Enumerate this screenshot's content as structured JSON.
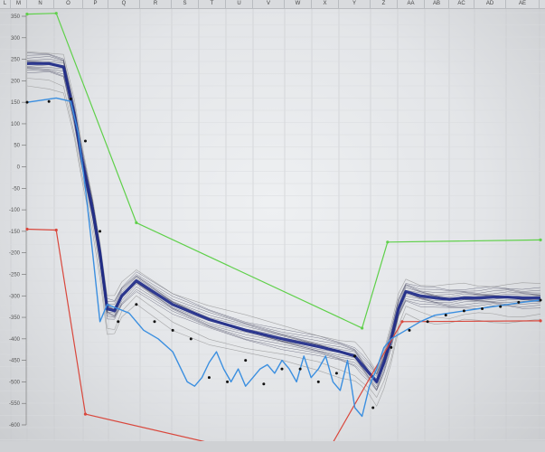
{
  "spreadsheet": {
    "columns": [
      "L",
      "M",
      "N",
      "O",
      "P",
      "Q",
      "R",
      "S",
      "T",
      "U",
      "V",
      "W",
      "X",
      "Y",
      "Z",
      "AA",
      "AB",
      "AC",
      "AD",
      "AE"
    ]
  },
  "chart_data": {
    "type": "line",
    "ylim": [
      -620,
      380
    ],
    "y_ticks": [
      350,
      300,
      250,
      200,
      150,
      100,
      50,
      0,
      -50,
      -100,
      -150,
      -200,
      -250,
      -300,
      -350,
      -400,
      -450,
      -500,
      -550,
      -600
    ],
    "y_tick_labels": [
      "350",
      "300",
      "250",
      "200",
      "150",
      "100",
      "50",
      "0",
      "-50",
      "-100",
      "-150",
      "-200",
      "-250",
      "-300",
      "-350",
      "-400",
      "-450",
      "-500",
      "-550",
      "-600"
    ],
    "grid": true,
    "colors": {
      "upper_limit": "#5fd04a",
      "lower_limit": "#d9473c",
      "mean": "#1e2a8a",
      "measured": "#3b8fe0",
      "envelope": "#202040",
      "gray_traces": "#8a8a8a"
    },
    "series": [
      {
        "role": "upper-limit",
        "x": [
          0,
          8,
          30,
          92,
          99,
          141
        ],
        "y": [
          355,
          357,
          -130,
          -375,
          -175,
          -170
        ]
      },
      {
        "role": "lower-limit",
        "x": [
          0,
          8,
          16,
          80,
          103,
          141
        ],
        "y": [
          -145,
          -147,
          -575,
          -700,
          -360,
          -358
        ]
      },
      {
        "role": "mean-trace",
        "x": [
          0,
          6,
          10,
          13,
          15,
          18,
          20,
          22,
          24,
          26,
          30,
          40,
          50,
          60,
          70,
          80,
          86,
          90,
          92,
          94,
          96,
          98,
          100,
          102,
          104,
          108,
          112,
          116,
          120,
          124,
          128,
          132,
          136,
          141
        ],
        "y": [
          240,
          240,
          232,
          120,
          20,
          -100,
          -200,
          -330,
          -335,
          -300,
          -265,
          -320,
          -355,
          -380,
          -400,
          -418,
          -430,
          -440,
          -460,
          -480,
          -500,
          -455,
          -400,
          -330,
          -290,
          -300,
          -305,
          -308,
          -305,
          -305,
          -303,
          -303,
          -305,
          -305
        ]
      },
      {
        "role": "measured",
        "x": [
          0,
          4,
          8,
          12,
          14,
          16,
          18,
          20,
          22,
          25,
          28,
          32,
          36,
          40,
          44,
          46,
          48,
          50,
          52,
          54,
          56,
          58,
          60,
          62,
          64,
          66,
          68,
          70,
          72,
          74,
          76,
          78,
          80,
          82,
          84,
          86,
          88,
          90,
          92,
          94,
          96,
          98,
          100,
          104,
          108,
          112,
          116,
          120,
          124,
          128,
          132,
          136,
          141
        ],
        "y": [
          150,
          155,
          160,
          152,
          80,
          -50,
          -200,
          -360,
          -320,
          -330,
          -340,
          -380,
          -400,
          -430,
          -500,
          -510,
          -490,
          -455,
          -430,
          -470,
          -500,
          -470,
          -510,
          -490,
          -470,
          -460,
          -480,
          -450,
          -470,
          -500,
          -440,
          -490,
          -470,
          -440,
          -500,
          -520,
          -450,
          -560,
          -580,
          -510,
          -470,
          -420,
          -400,
          -380,
          -360,
          -345,
          -340,
          -335,
          -330,
          -325,
          -320,
          -315,
          -310
        ]
      },
      {
        "role": "dotted-trace",
        "x": [
          0,
          6,
          12,
          16,
          20,
          25,
          30,
          35,
          40,
          45,
          50,
          55,
          60,
          65,
          70,
          75,
          80,
          85,
          90,
          95,
          100,
          105,
          110,
          115,
          120,
          125,
          130,
          135,
          141
        ],
        "y": [
          150,
          152,
          158,
          60,
          -150,
          -360,
          -320,
          -360,
          -380,
          -400,
          -490,
          -500,
          -450,
          -505,
          -470,
          -470,
          -500,
          -480,
          -440,
          -560,
          -420,
          -380,
          -360,
          -345,
          -335,
          -330,
          -325,
          -315,
          -310
        ]
      }
    ]
  }
}
